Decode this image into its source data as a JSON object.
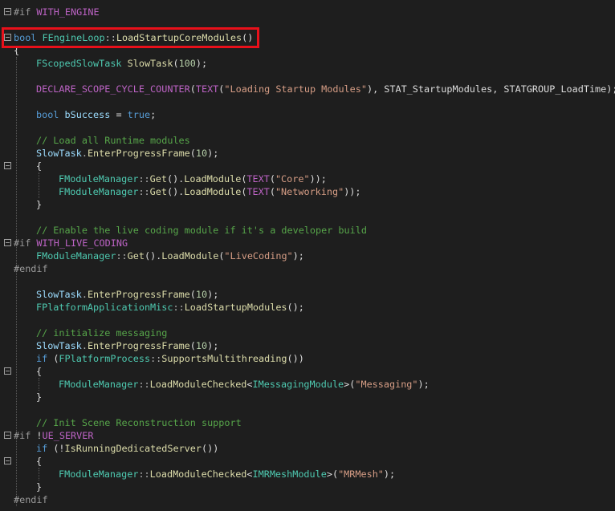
{
  "editor": {
    "language": "C++",
    "colors": {
      "background": "#1e1e1e",
      "keyword": "#569cd6",
      "type": "#4ec9b0",
      "function": "#dcdcaa",
      "string": "#d69d85",
      "comment": "#57a64a",
      "macro": "#bd63c5",
      "preprocessor": "#9b9b9b",
      "plain": "#dcdcdc",
      "highlight_box": "#e8101a"
    },
    "lines": [
      {
        "indent": 0,
        "fold": true,
        "tokens": [
          {
            "cls": "pp",
            "text": "#if "
          },
          {
            "cls": "m",
            "text": "WITH_ENGINE"
          }
        ]
      },
      {
        "indent": 0,
        "tokens": []
      },
      {
        "indent": 0,
        "fold": true,
        "tokens": [
          {
            "cls": "k",
            "text": "bool "
          },
          {
            "cls": "t",
            "text": "FEngineLoop"
          },
          {
            "cls": "op",
            "text": "::"
          },
          {
            "cls": "f",
            "text": "LoadStartupCoreModules"
          },
          {
            "cls": "p",
            "text": "()"
          }
        ]
      },
      {
        "indent": 0,
        "tokens": [
          {
            "cls": "p",
            "text": "{"
          }
        ]
      },
      {
        "indent": 1,
        "tokens": [
          {
            "cls": "t",
            "text": "FScopedSlowTask "
          },
          {
            "cls": "f",
            "text": "SlowTask"
          },
          {
            "cls": "p",
            "text": "("
          },
          {
            "cls": "n",
            "text": "100"
          },
          {
            "cls": "p",
            "text": ");"
          }
        ]
      },
      {
        "indent": 0,
        "tokens": []
      },
      {
        "indent": 1,
        "tokens": [
          {
            "cls": "m",
            "text": "DECLARE_SCOPE_CYCLE_COUNTER"
          },
          {
            "cls": "p",
            "text": "("
          },
          {
            "cls": "m",
            "text": "TEXT"
          },
          {
            "cls": "p",
            "text": "("
          },
          {
            "cls": "s",
            "text": "\"Loading Startup Modules\""
          },
          {
            "cls": "p",
            "text": "), STAT_StartupModules, STATGROUP_LoadTime);"
          }
        ]
      },
      {
        "indent": 0,
        "tokens": []
      },
      {
        "indent": 1,
        "tokens": [
          {
            "cls": "k",
            "text": "bool "
          },
          {
            "cls": "v",
            "text": "bSuccess"
          },
          {
            "cls": "p",
            "text": " = "
          },
          {
            "cls": "k",
            "text": "true"
          },
          {
            "cls": "p",
            "text": ";"
          }
        ]
      },
      {
        "indent": 0,
        "tokens": []
      },
      {
        "indent": 1,
        "tokens": [
          {
            "cls": "c",
            "text": "// Load all Runtime modules"
          }
        ]
      },
      {
        "indent": 1,
        "tokens": [
          {
            "cls": "v",
            "text": "SlowTask"
          },
          {
            "cls": "op",
            "text": "."
          },
          {
            "cls": "f",
            "text": "EnterProgressFrame"
          },
          {
            "cls": "p",
            "text": "("
          },
          {
            "cls": "n",
            "text": "10"
          },
          {
            "cls": "p",
            "text": ");"
          }
        ]
      },
      {
        "indent": 1,
        "fold": true,
        "tokens": [
          {
            "cls": "p",
            "text": "{"
          }
        ]
      },
      {
        "indent": 2,
        "tokens": [
          {
            "cls": "t",
            "text": "FModuleManager"
          },
          {
            "cls": "op",
            "text": "::"
          },
          {
            "cls": "f",
            "text": "Get"
          },
          {
            "cls": "p",
            "text": "()."
          },
          {
            "cls": "f",
            "text": "LoadModule"
          },
          {
            "cls": "p",
            "text": "("
          },
          {
            "cls": "m",
            "text": "TEXT"
          },
          {
            "cls": "p",
            "text": "("
          },
          {
            "cls": "s",
            "text": "\"Core\""
          },
          {
            "cls": "p",
            "text": "));"
          }
        ]
      },
      {
        "indent": 2,
        "tokens": [
          {
            "cls": "t",
            "text": "FModuleManager"
          },
          {
            "cls": "op",
            "text": "::"
          },
          {
            "cls": "f",
            "text": "Get"
          },
          {
            "cls": "p",
            "text": "()."
          },
          {
            "cls": "f",
            "text": "LoadModule"
          },
          {
            "cls": "p",
            "text": "("
          },
          {
            "cls": "m",
            "text": "TEXT"
          },
          {
            "cls": "p",
            "text": "("
          },
          {
            "cls": "s",
            "text": "\"Networking\""
          },
          {
            "cls": "p",
            "text": "));"
          }
        ]
      },
      {
        "indent": 1,
        "tokens": [
          {
            "cls": "p",
            "text": "}"
          }
        ]
      },
      {
        "indent": 0,
        "tokens": []
      },
      {
        "indent": 1,
        "tokens": [
          {
            "cls": "c",
            "text": "// Enable the live coding module if it's a developer build"
          }
        ]
      },
      {
        "indent": 0,
        "fold": true,
        "tokens": [
          {
            "cls": "pp",
            "text": "#if "
          },
          {
            "cls": "m",
            "text": "WITH_LIVE_CODING"
          }
        ]
      },
      {
        "indent": 1,
        "tokens": [
          {
            "cls": "t",
            "text": "FModuleManager"
          },
          {
            "cls": "op",
            "text": "::"
          },
          {
            "cls": "f",
            "text": "Get"
          },
          {
            "cls": "p",
            "text": "()."
          },
          {
            "cls": "f",
            "text": "LoadModule"
          },
          {
            "cls": "p",
            "text": "("
          },
          {
            "cls": "s",
            "text": "\"LiveCoding\""
          },
          {
            "cls": "p",
            "text": ");"
          }
        ]
      },
      {
        "indent": 0,
        "tokens": [
          {
            "cls": "pp",
            "text": "#endif"
          }
        ]
      },
      {
        "indent": 0,
        "tokens": []
      },
      {
        "indent": 1,
        "tokens": [
          {
            "cls": "v",
            "text": "SlowTask"
          },
          {
            "cls": "op",
            "text": "."
          },
          {
            "cls": "f",
            "text": "EnterProgressFrame"
          },
          {
            "cls": "p",
            "text": "("
          },
          {
            "cls": "n",
            "text": "10"
          },
          {
            "cls": "p",
            "text": ");"
          }
        ]
      },
      {
        "indent": 1,
        "tokens": [
          {
            "cls": "t",
            "text": "FPlatformApplicationMisc"
          },
          {
            "cls": "op",
            "text": "::"
          },
          {
            "cls": "f",
            "text": "LoadStartupModules"
          },
          {
            "cls": "p",
            "text": "();"
          }
        ]
      },
      {
        "indent": 0,
        "tokens": []
      },
      {
        "indent": 1,
        "tokens": [
          {
            "cls": "c",
            "text": "// initialize messaging"
          }
        ]
      },
      {
        "indent": 1,
        "tokens": [
          {
            "cls": "v",
            "text": "SlowTask"
          },
          {
            "cls": "op",
            "text": "."
          },
          {
            "cls": "f",
            "text": "EnterProgressFrame"
          },
          {
            "cls": "p",
            "text": "("
          },
          {
            "cls": "n",
            "text": "10"
          },
          {
            "cls": "p",
            "text": ");"
          }
        ]
      },
      {
        "indent": 1,
        "tokens": [
          {
            "cls": "k",
            "text": "if "
          },
          {
            "cls": "p",
            "text": "("
          },
          {
            "cls": "t",
            "text": "FPlatformProcess"
          },
          {
            "cls": "op",
            "text": "::"
          },
          {
            "cls": "f",
            "text": "SupportsMultithreading"
          },
          {
            "cls": "p",
            "text": "())"
          }
        ]
      },
      {
        "indent": 1,
        "fold": true,
        "tokens": [
          {
            "cls": "p",
            "text": "{"
          }
        ]
      },
      {
        "indent": 2,
        "tokens": [
          {
            "cls": "t",
            "text": "FModuleManager"
          },
          {
            "cls": "op",
            "text": "::"
          },
          {
            "cls": "f",
            "text": "LoadModuleChecked"
          },
          {
            "cls": "p",
            "text": "<"
          },
          {
            "cls": "t",
            "text": "IMessagingModule"
          },
          {
            "cls": "p",
            "text": ">("
          },
          {
            "cls": "s",
            "text": "\"Messaging\""
          },
          {
            "cls": "p",
            "text": ");"
          }
        ]
      },
      {
        "indent": 1,
        "tokens": [
          {
            "cls": "p",
            "text": "}"
          }
        ]
      },
      {
        "indent": 0,
        "tokens": []
      },
      {
        "indent": 1,
        "tokens": [
          {
            "cls": "c",
            "text": "// Init Scene Reconstruction support"
          }
        ]
      },
      {
        "indent": 0,
        "fold": true,
        "tokens": [
          {
            "cls": "pp",
            "text": "#if "
          },
          {
            "cls": "p",
            "text": "!"
          },
          {
            "cls": "m",
            "text": "UE_SERVER"
          }
        ]
      },
      {
        "indent": 1,
        "tokens": [
          {
            "cls": "k",
            "text": "if "
          },
          {
            "cls": "p",
            "text": "(!"
          },
          {
            "cls": "f",
            "text": "IsRunningDedicatedServer"
          },
          {
            "cls": "p",
            "text": "())"
          }
        ]
      },
      {
        "indent": 1,
        "fold": true,
        "tokens": [
          {
            "cls": "p",
            "text": "{"
          }
        ]
      },
      {
        "indent": 2,
        "tokens": [
          {
            "cls": "t",
            "text": "FModuleManager"
          },
          {
            "cls": "op",
            "text": "::"
          },
          {
            "cls": "f",
            "text": "LoadModuleChecked"
          },
          {
            "cls": "p",
            "text": "<"
          },
          {
            "cls": "t",
            "text": "IMRMeshModule"
          },
          {
            "cls": "p",
            "text": ">("
          },
          {
            "cls": "s",
            "text": "\"MRMesh\""
          },
          {
            "cls": "p",
            "text": ");"
          }
        ]
      },
      {
        "indent": 1,
        "tokens": [
          {
            "cls": "p",
            "text": "}"
          }
        ]
      },
      {
        "indent": 0,
        "tokens": [
          {
            "cls": "pp",
            "text": "#endif"
          }
        ]
      }
    ]
  }
}
